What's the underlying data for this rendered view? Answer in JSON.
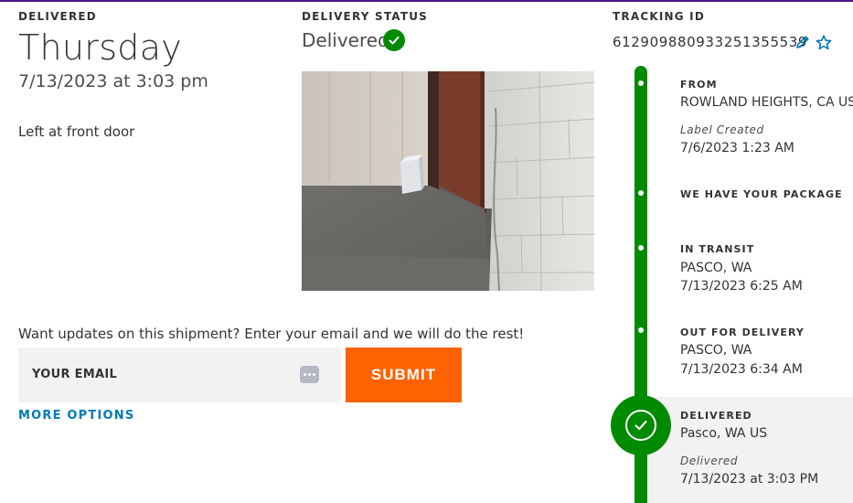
{
  "delivered": {
    "caption": "DELIVERED",
    "weekday": "Thursday",
    "datetime": "7/13/2023 at 3:03 pm",
    "note": "Left at front door"
  },
  "delivery_status": {
    "caption": "DELIVERY STATUS",
    "value": "Delivered",
    "photo": "delivery-photo-package-at-door"
  },
  "tracking": {
    "caption": "TRACKING ID",
    "number": "612909880933251355 39",
    "number_full": "612909880933251355539",
    "edit_icon": "pencil-icon",
    "watch_icon": "star-icon"
  },
  "updates": {
    "prompt": "Want updates on this shipment? Enter your email and we will do the rest!",
    "email_placeholder": "YOUR EMAIL",
    "submit_label": "SUBMIT",
    "more_options": "MORE OPTIONS"
  },
  "timeline": [
    {
      "title": "FROM",
      "line1": "ROWLAND HEIGHTS, CA US",
      "status": "Label Created",
      "time": "7/6/2023 1:23 AM"
    },
    {
      "title": "WE HAVE YOUR PACKAGE"
    },
    {
      "title": "IN TRANSIT",
      "line1": "PASCO, WA",
      "time": "7/13/2023 6:25 AM"
    },
    {
      "title": "OUT FOR DELIVERY",
      "line1": "PASCO, WA",
      "time": "7/13/2023 6:34 AM"
    },
    {
      "title": "DELIVERED",
      "line1": "Pasco, WA US",
      "status": "Delivered",
      "time": "7/13/2023 at 3:03 PM"
    }
  ],
  "colors": {
    "accent_green": "#008a00",
    "submit_orange": "#ff6200",
    "link_blue": "#007ab7",
    "brand_purple": "#4d148c"
  }
}
